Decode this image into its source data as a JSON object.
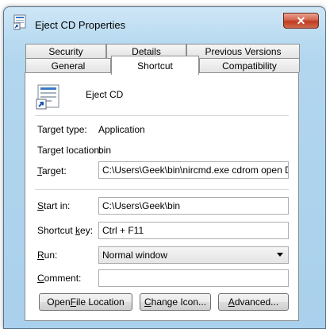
{
  "window": {
    "title": "Eject CD Properties",
    "close_glyph": "✕"
  },
  "tabs_top": [
    {
      "label": "Security"
    },
    {
      "label": "Details"
    },
    {
      "label": "Previous Versions"
    }
  ],
  "tabs_bottom": [
    {
      "label": "General"
    },
    {
      "label": "Shortcut"
    },
    {
      "label": "Compatibility"
    }
  ],
  "shortcut": {
    "name": "Eject CD",
    "target_type_label": "Target type:",
    "target_type_value": "Application",
    "target_location_label": "Target location:",
    "target_location_value": "bin",
    "target_label_prefix": "T",
    "target_label_rest": "arget:",
    "target_value": "C:\\Users\\Geek\\bin\\nircmd.exe cdrom open D:",
    "start_in_label_prefix": "S",
    "start_in_label_rest": "tart in:",
    "start_in_value": "C:\\Users\\Geek\\bin",
    "shortcut_key_label_prefix": "Shortcut ",
    "shortcut_key_label_u": "k",
    "shortcut_key_label_rest": "ey:",
    "shortcut_key_value": "Ctrl + F11",
    "run_label_prefix": "R",
    "run_label_rest": "un:",
    "run_value": "Normal window",
    "comment_label_prefix": "C",
    "comment_label_u": "o",
    "comment_label_rest": "mment:",
    "comment_value": ""
  },
  "buttons": {
    "open_location_a": "Open ",
    "open_location_u": "F",
    "open_location_b": "ile Location",
    "change_icon_u": "C",
    "change_icon_b": "hange Icon...",
    "advanced_u": "A",
    "advanced_b": "dvanced..."
  }
}
